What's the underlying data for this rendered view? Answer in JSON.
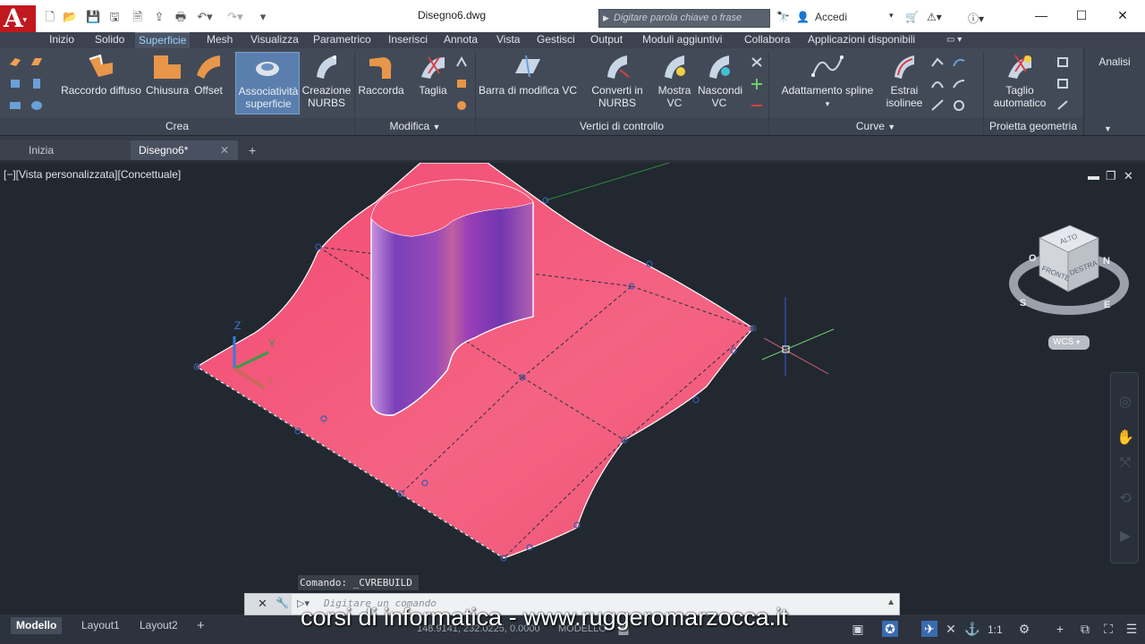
{
  "titlebar": {
    "app_letter": "A",
    "document_title": "Disegno6.dwg",
    "search_placeholder": "Digitare parola chiave o frase",
    "signin_label": "Accedi"
  },
  "menubar": {
    "items": [
      "Inizio",
      "Solido",
      "Superficie",
      "Mesh",
      "Visualizza",
      "Parametrico",
      "Inserisci",
      "Annota",
      "Vista",
      "Gestisci",
      "Output",
      "Moduli aggiuntivi",
      "Collabora",
      "Applicazioni disponibili"
    ],
    "active": "Superficie"
  },
  "ribbon": {
    "crea": {
      "label": "Crea",
      "buttons": [
        "Raccordo diffuso",
        "Chiusura",
        "Offset",
        "Associatività superficie",
        "Creazione NURBS"
      ]
    },
    "modifica": {
      "label": "Modifica",
      "buttons": [
        "Raccorda",
        "Taglia"
      ]
    },
    "vertici": {
      "label": "Vertici di controllo",
      "buttons": [
        "Barra di modifica VC",
        "Converti in NURBS",
        "Mostra VC",
        "Nascondi VC"
      ]
    },
    "curve": {
      "label": "Curve",
      "buttons": [
        "Adattamento spline",
        "Estrai isolinee"
      ]
    },
    "proietta": {
      "label": "Proietta geometria",
      "buttons": [
        "Taglio automatico"
      ]
    },
    "analisi": {
      "label": "Analisi"
    }
  },
  "doctabs": {
    "tabs": [
      "Inizia",
      "Disegno6*"
    ],
    "active": "Disegno6*"
  },
  "viewport": {
    "label": "[−][Vista personalizzata][Concettuale]",
    "viewcube": {
      "top": "ALTO",
      "front": "FRONTE",
      "right": "DESTRA"
    },
    "compass": {
      "north": "N",
      "south": "S",
      "east": "E",
      "west": "O"
    },
    "wcs_label": "WCS",
    "ucs": {
      "z": "Z",
      "y": "Y",
      "x": "X"
    },
    "surface_color": "#f4567a",
    "cylinder_color": "#8a3fb0"
  },
  "command": {
    "history": "Comando: _CVREBUILD",
    "placeholder": "Digitare un comando"
  },
  "statusbar": {
    "tabs": [
      "Modello",
      "Layout1",
      "Layout2"
    ],
    "active": "Modello",
    "coordinates": "148.9141, 232.0225, 0.0000",
    "space": "MODELLO",
    "scale": "1:1"
  },
  "watermark": "corsi di informatica - www.ruggeromarzocca.it"
}
